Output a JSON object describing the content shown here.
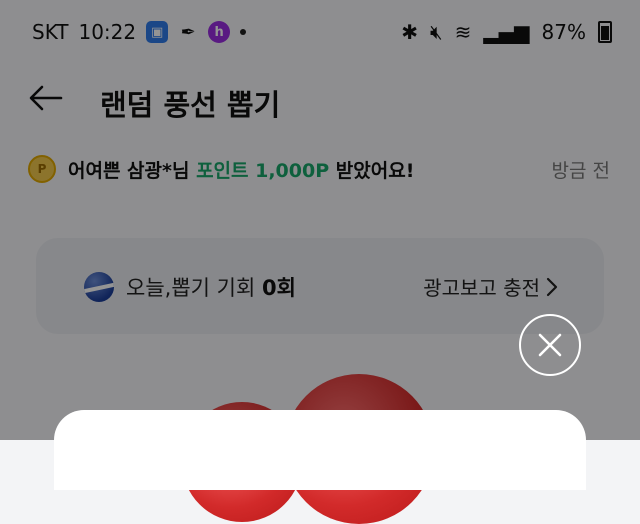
{
  "status_bar": {
    "carrier": "SKT",
    "time": "10:22",
    "battery": "87%"
  },
  "header": {
    "title": "랜덤 풍선 뽑기"
  },
  "notice": {
    "prefix": "어여쁜 삼광*님",
    "point": "포인트 1,000P",
    "suffix": "받았어요!",
    "time": "방금 전"
  },
  "chance": {
    "label": "오늘,뽑기 기회",
    "count": "0회",
    "charge_label": "광고보고 충전"
  },
  "colors": {
    "accent_green": "#19a56a",
    "balloon_red": "#d22a2a"
  }
}
